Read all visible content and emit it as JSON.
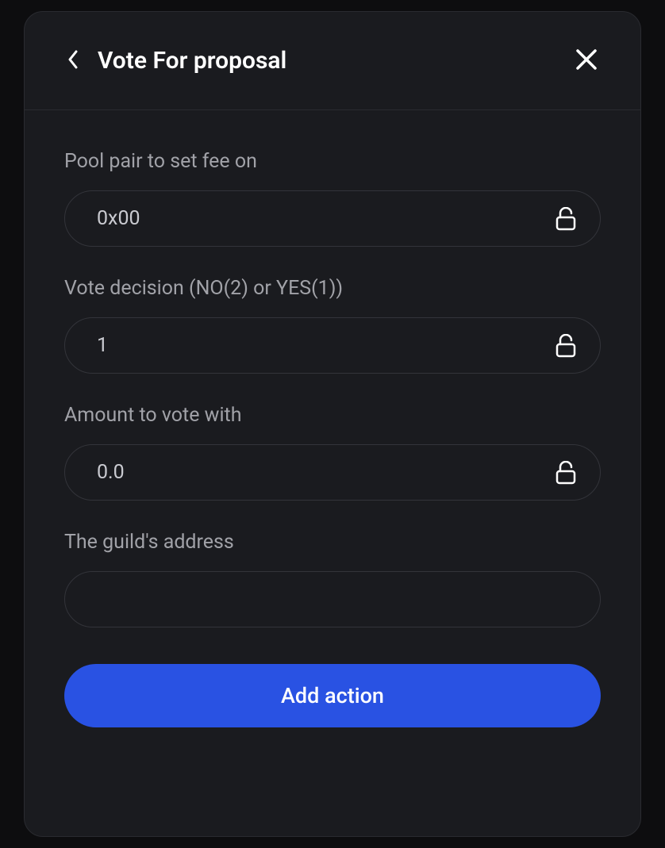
{
  "header": {
    "title": "Vote For proposal"
  },
  "fields": [
    {
      "label": "Pool pair to set fee on",
      "value": "0x00",
      "hasLock": true
    },
    {
      "label": "Vote decision (NO(2) or YES(1))",
      "value": "1",
      "hasLock": true
    },
    {
      "label": "Amount to vote with",
      "value": "0.0",
      "hasLock": true
    },
    {
      "label": "The guild's address",
      "value": "",
      "hasLock": false
    }
  ],
  "action": {
    "label": "Add action"
  }
}
